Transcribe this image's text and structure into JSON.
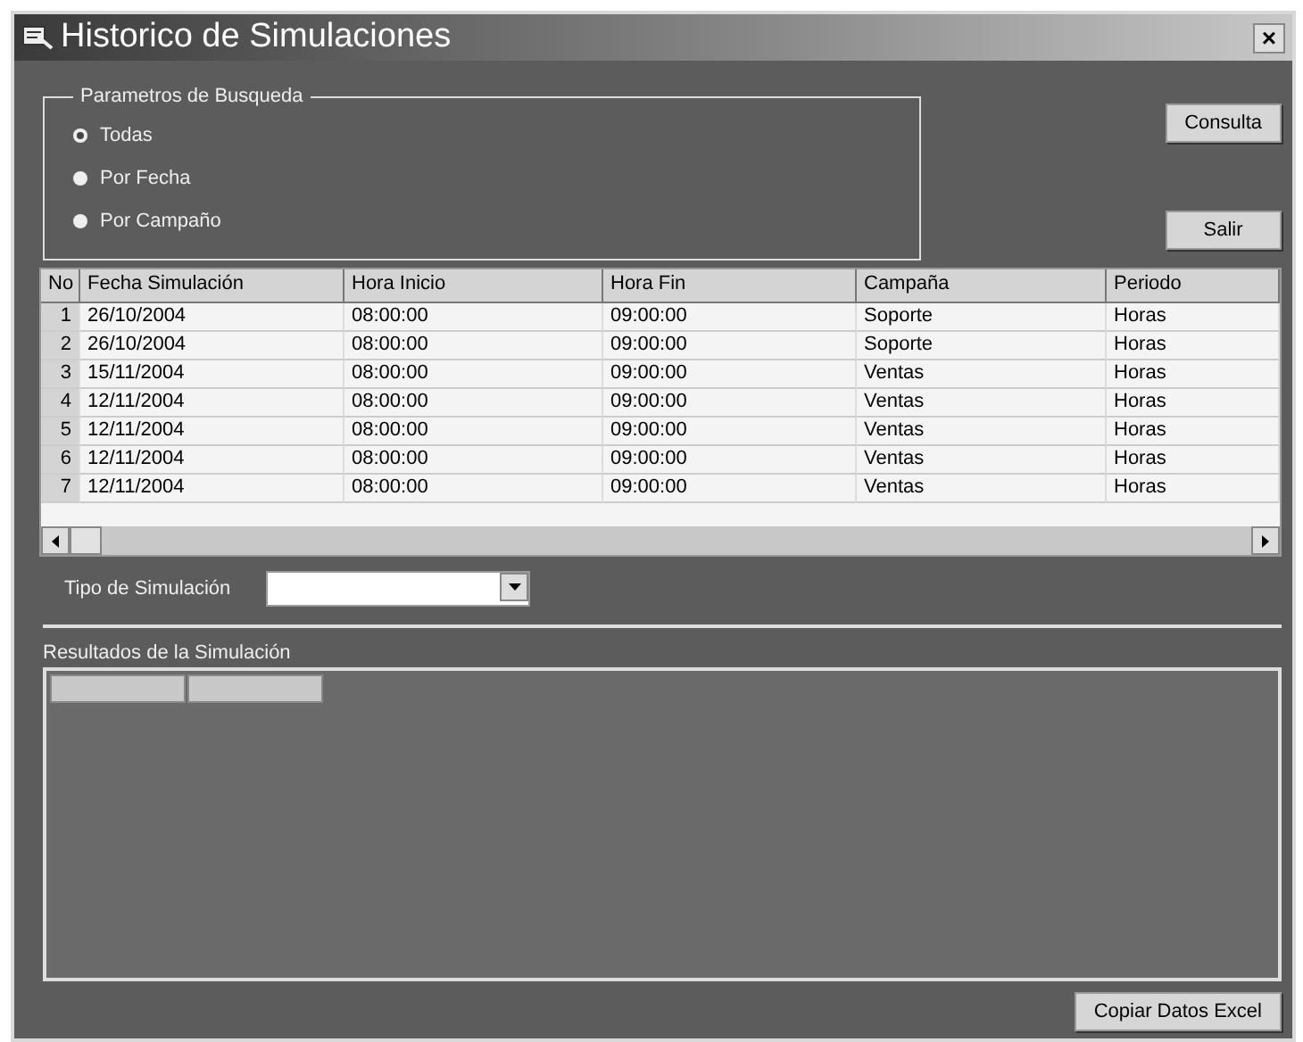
{
  "window": {
    "title": "Historico de Simulaciones",
    "close": "×"
  },
  "search_group": {
    "title": "Parametros de Busqueda",
    "options": [
      {
        "label": "Todas",
        "selected": true
      },
      {
        "label": "Por Fecha",
        "selected": false
      },
      {
        "label": "Por Campaño",
        "selected": false
      }
    ]
  },
  "buttons": {
    "query": "Consulta",
    "exit": "Salir"
  },
  "table": {
    "columns": [
      "No",
      "Fecha Simulación",
      "Hora Inicio",
      "Hora Fin",
      "Campaña",
      "Periodo"
    ],
    "rows": [
      {
        "cells": [
          "1",
          "26/10/2004",
          "08:00:00",
          "09:00:00",
          "Soporte",
          "Horas"
        ]
      },
      {
        "cells": [
          "2",
          "26/10/2004",
          "08:00:00",
          "09:00:00",
          "Soporte",
          "Horas"
        ]
      },
      {
        "cells": [
          "3",
          "15/11/2004",
          "08:00:00",
          "09:00:00",
          "Ventas",
          "Horas"
        ]
      },
      {
        "cells": [
          "4",
          "12/11/2004",
          "08:00:00",
          "09:00:00",
          "Ventas",
          "Horas"
        ]
      },
      {
        "cells": [
          "5",
          "12/11/2004",
          "08:00:00",
          "09:00:00",
          "Ventas",
          "Horas"
        ]
      },
      {
        "cells": [
          "6",
          "12/11/2004",
          "08:00:00",
          "09:00:00",
          "Ventas",
          "Horas"
        ]
      },
      {
        "cells": [
          "7",
          "12/11/2004",
          "08:00:00",
          "09:00:00",
          "Ventas",
          "Horas"
        ]
      }
    ]
  },
  "simulation_type": {
    "label": "Tipo de Simulación"
  },
  "results": {
    "title": "Resultados de la Simulación"
  },
  "copy_button": "Copiar Datos Excel"
}
